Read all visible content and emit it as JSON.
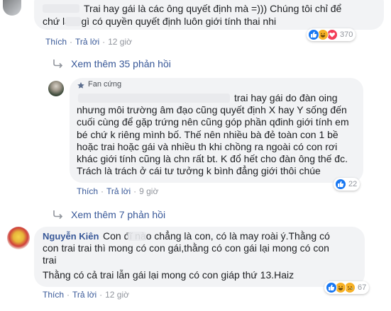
{
  "comment1": {
    "text_line1": "Trai hay gái là các ông quyết định mà =))) Chúng tôi chỉ để",
    "text_line2": "chứ làm gì có quyền quyết định luôn giới tính thai nhi",
    "action_like": "Thích",
    "action_reply": "Trả lời",
    "time": "12 giờ",
    "reaction_count": "370"
  },
  "more_replies_1": "Xem thêm 35 phản hồi",
  "reply": {
    "badge_label": "Fan cứng",
    "text_lines": [
      "trai hay gái do đàn oing",
      "nhưng môi trường âm đạo cũng quyết định X hay Y sống đến",
      "cuối cùng để gặp trứng nên cũng góp phần qđinh giới tính em",
      "bé chứ k riêng mình bố. Thế nên nhiều bà đẻ toàn con 1 bề",
      "hoặc trai hoặc gái và nhiều th khi chồng ra ngoài có con rơi",
      "khác giới tính cũng là chn rất bt. K đổ hết cho đàn ông thế đc.",
      "Trách là trách ở cái tư tưởng k bình đẳng giới thôi chúe"
    ],
    "action_like": "Thích",
    "action_reply": "Trả lời",
    "time": "9 giờ",
    "reaction_count": "22"
  },
  "more_replies_2": "Xem thêm 7 phản hồi",
  "comment2": {
    "author": "Nguyễn Kiên",
    "text_lines": [
      "Con đĩ nào chẳng là con, có là may roài ý.Thằng có",
      "con trai trai thì mong có con gái,thằng có con gái lại mong có con",
      "trai",
      "Thằng có cả trai lẫn gái lại mong có con giáp thứ 13.Haiz"
    ],
    "action_like": "Thích",
    "action_reply": "Trả lời",
    "time": "12 giờ",
    "reaction_count": "67"
  },
  "colors": {
    "link_blue": "#385898",
    "bubble_bg": "#f2f3f5",
    "like_blue": "#1877f2",
    "haha_yellow": "#f7b125",
    "love_red": "#f33e58"
  }
}
